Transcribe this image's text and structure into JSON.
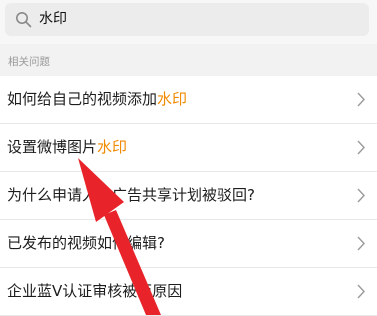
{
  "search": {
    "query": "水印"
  },
  "section": {
    "title": "相关问题"
  },
  "questions": [
    {
      "text": "如何给自己的视频添加",
      "highlight": "水印",
      "suffix": ""
    },
    {
      "text": "设置微博图片",
      "highlight": "水印",
      "suffix": ""
    },
    {
      "text": "为什么申请入驻广告共享计划被驳回?",
      "highlight": "",
      "suffix": ""
    },
    {
      "text": "已发布的视频如何编辑?",
      "highlight": "",
      "suffix": ""
    },
    {
      "text": "企业蓝V认证审核被拒原因",
      "highlight": "",
      "suffix": ""
    }
  ],
  "colors": {
    "highlight": "#f08a00",
    "arrow": "#e8232a"
  },
  "icons": {
    "search": "search-icon",
    "row_chevron": "chevron-right-icon",
    "annotation": "red-arrow-annotation"
  }
}
